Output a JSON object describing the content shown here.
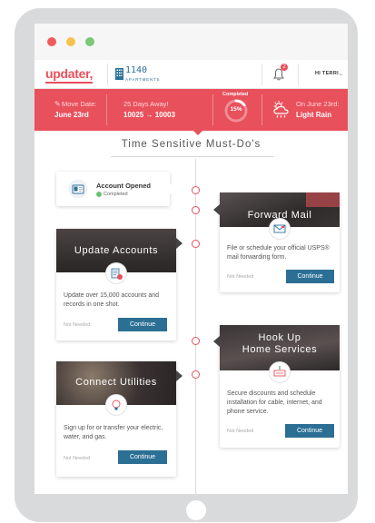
{
  "header": {
    "logo": "updater,",
    "building_number": "1140",
    "building_sub": "APARTMENTS",
    "notification_count": "2",
    "user_greeting": "HI TERRI"
  },
  "status_bar": {
    "move_date_label": "Move Date:",
    "move_date_value": "June 23rd",
    "days_away_label": "25 Days Away!",
    "route": "10025  →  10003",
    "completed_label": "Completed",
    "completed_percent": "15%",
    "completed_fraction": 0.15,
    "weather_label": "On June 23rd:",
    "weather_value": "Light Rain"
  },
  "timeline": {
    "title": "Time Sensitive Must-Do's"
  },
  "cards": {
    "account_opened": {
      "title": "Account Opened",
      "status": "Completed"
    },
    "forward_mail": {
      "title": "Forward Mail",
      "desc": "File or schedule your official USPS® mail forwarding form.",
      "not_needed": "Not Needed",
      "button": "Continue"
    },
    "update_accounts": {
      "title": "Update Accounts",
      "desc": "Update over 15,000 accounts and records in one shot.",
      "not_needed": "Not Needed",
      "button": "Continue"
    },
    "home_services": {
      "title_line1": "Hook Up",
      "title_line2": "Home Services",
      "desc": "Secure discounts and schedule installation for cable, internet, and phone service.",
      "not_needed": "Not Needed",
      "button": "Continue"
    },
    "connect_utilities": {
      "title": "Connect Utilities",
      "desc": "Sign up for or transfer your electric, water, and gas.",
      "not_needed": "Not Needed",
      "button": "Continue"
    }
  },
  "colors": {
    "brand_red": "#e8505b",
    "button_blue": "#2c6f94",
    "device_gray": "#d9dadb"
  },
  "icons": [
    "pencil-icon",
    "building-icon",
    "bell-icon",
    "chevron-down-icon",
    "progress-ring",
    "rain-cloud-icon",
    "id-card-icon",
    "mail-icon",
    "documents-icon",
    "power-icon",
    "lightbulb-icon"
  ]
}
